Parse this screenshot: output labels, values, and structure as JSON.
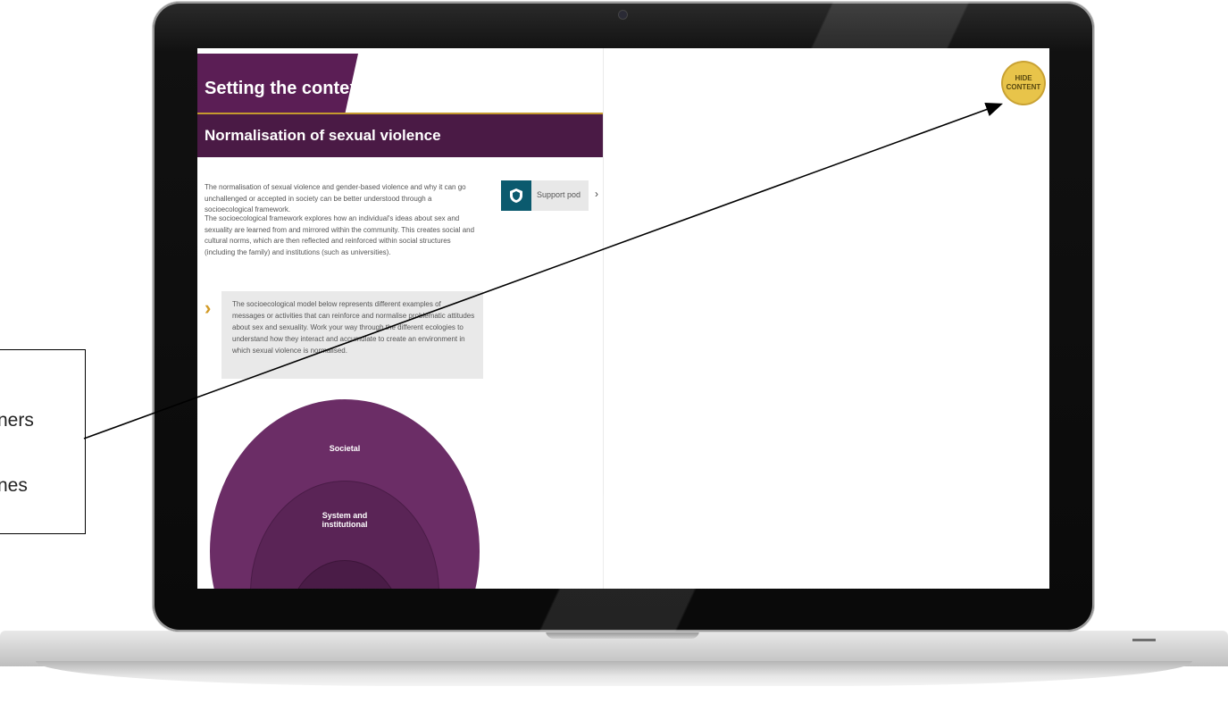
{
  "screen": {
    "title": "Setting the context",
    "banner": "Normalisation of sexual violence",
    "paragraphs": [
      "The normalisation of sexual violence and gender-based violence and why it can go unchallenged or accepted in society can be better understood through a socioecological framework.",
      "The socioecological framework explores how an individual's ideas about sex and sexuality are learned from and mirrored within the community. This creates social and cultural norms, which are then reflected and reinforced within social structures (including the family) and institutions (such as universities)."
    ],
    "support_pod_label": "Support pod",
    "callout_text": "The socioecological model below represents different examples of messages or activities that can reinforce and normalise problematic attitudes about sex and sexuality. Work your way through the different ecologies to understand how they interact and accumulate to create an environment in which sexual violence is normalised.",
    "rings": {
      "societal": "Societal",
      "system": "System and institutional"
    },
    "hide_button": "HIDE CONTENT"
  },
  "annotation": {
    "line1": "ners",
    "line2": "nes"
  },
  "colors": {
    "plum": "#5b1e55",
    "plum_dark": "#4a1a45",
    "gold": "#c59a2e",
    "ring_outer": "#6b2d66",
    "ring_middle": "#5a2456",
    "ring_inner": "#4a1c47"
  }
}
